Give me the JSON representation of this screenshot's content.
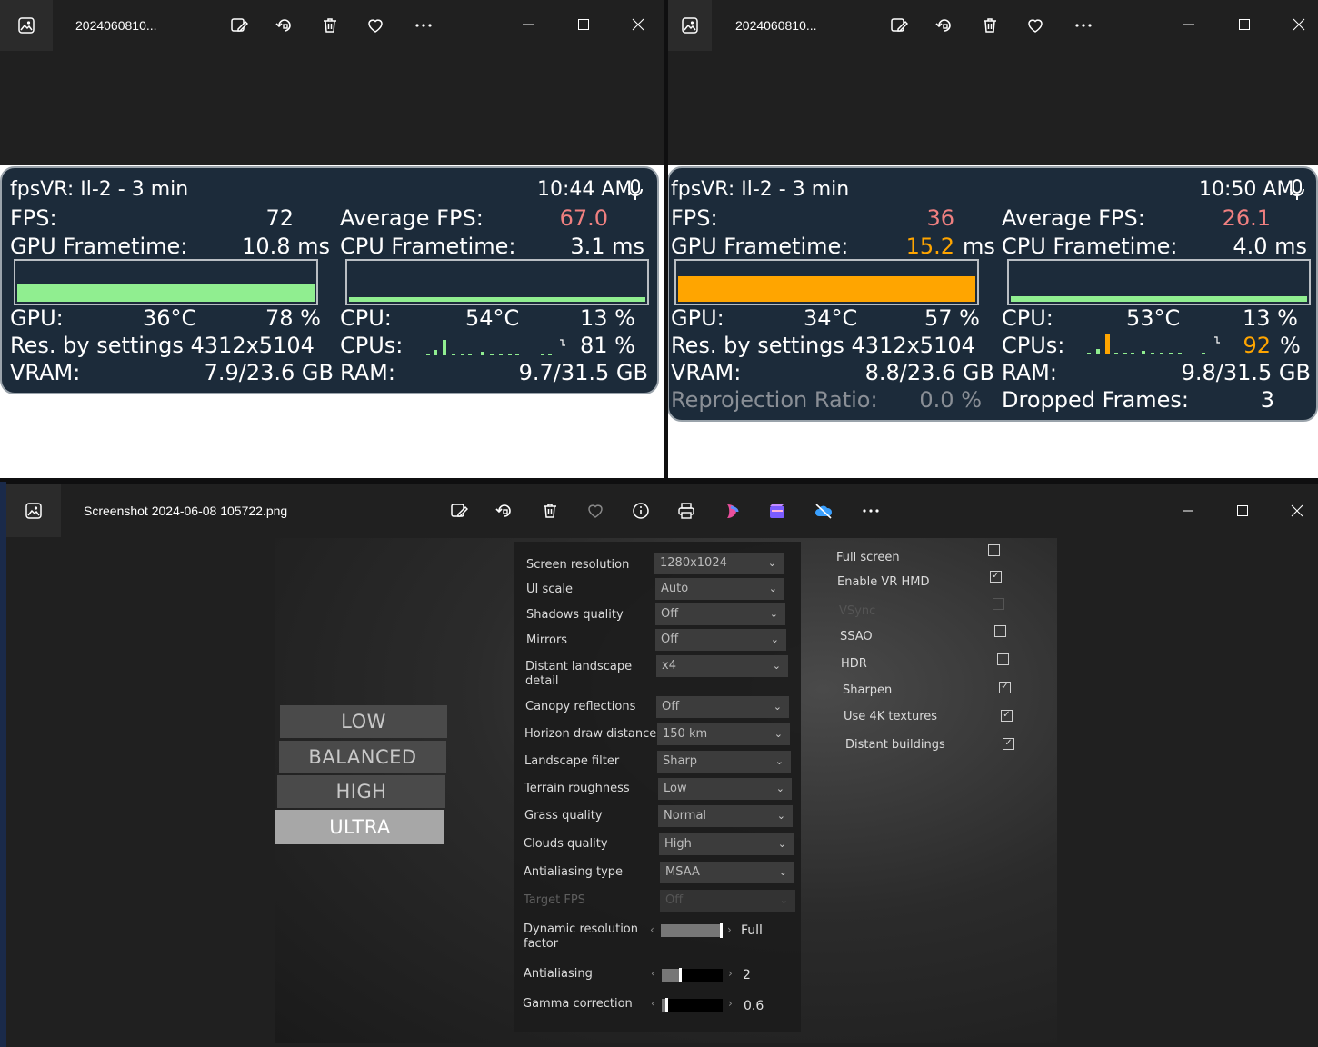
{
  "window_left": {
    "title": "2024060810...",
    "overlay": {
      "header": "fpsVR: Il-2 - 3 min",
      "time": "10:44 AM",
      "fps_label": "FPS:",
      "fps_value": "72",
      "avg_fps_label": "Average FPS:",
      "avg_fps_value": "67.0",
      "gpu_ft_label": "GPU Frametime:",
      "gpu_ft_value": "10.8 ms",
      "cpu_ft_label": "CPU Frametime:",
      "cpu_ft_value": "3.1 ms",
      "gpu_label": "GPU:",
      "gpu_temp": "36°C",
      "gpu_load": "78 %",
      "cpu_label": "CPU:",
      "cpu_temp": "54°C",
      "cpu_load": "13 %",
      "res_label": "Res. by settings 4312x5104",
      "cpus_label": "CPUs:",
      "cpus_value": "81 %",
      "vram_label": "VRAM:",
      "vram_value": "7.9/23.6 GB",
      "ram_label": "RAM:",
      "ram_value": "9.7/31.5 GB",
      "gpu_bar_color": "#90ee90",
      "avg_color": "#f08080"
    }
  },
  "window_right": {
    "title": "2024060810...",
    "overlay": {
      "header": "fpsVR: Il-2 - 3 min",
      "time": "10:50 AM",
      "fps_label": "FPS:",
      "fps_value": "36",
      "avg_fps_label": "Average FPS:",
      "avg_fps_value": "26.1",
      "gpu_ft_label": "GPU Frametime:",
      "gpu_ft_value": "15.2",
      "gpu_ft_unit": "ms",
      "cpu_ft_label": "CPU Frametime:",
      "cpu_ft_value": "4.0 ms",
      "gpu_label": "GPU:",
      "gpu_temp": "34°C",
      "gpu_load": "57 %",
      "cpu_label": "CPU:",
      "cpu_temp": "53°C",
      "cpu_load": "13 %",
      "res_label": "Res. by settings 4312x5104",
      "cpus_label": "CPUs:",
      "cpus_value": "92",
      "cpus_unit": "%",
      "vram_label": "VRAM:",
      "vram_value": "8.8/23.6 GB",
      "ram_label": "RAM:",
      "ram_value": "9.8/31.5 GB",
      "reproj_label": "Reprojection Ratio:",
      "reproj_value": "0.0 %",
      "dropped_label": "Dropped Frames:",
      "dropped_value": "3",
      "gpu_bar_color": "#ffa500",
      "warn_color": "#f08080",
      "orange_color": "#ffa500"
    }
  },
  "window_bottom": {
    "title": "Screenshot 2024-06-08 105722.png",
    "presets": [
      "LOW",
      "BALANCED",
      "HIGH",
      "ULTRA"
    ],
    "settings": [
      {
        "label": "Screen resolution",
        "value": "1280x1024"
      },
      {
        "label": "UI scale",
        "value": "Auto"
      },
      {
        "label": "Shadows quality",
        "value": "Off"
      },
      {
        "label": "Mirrors",
        "value": "Off"
      },
      {
        "label": "Distant landscape detail",
        "value": "x4"
      },
      {
        "label": "Canopy reflections",
        "value": "Off"
      },
      {
        "label": "Horizon draw distance",
        "value": "150 km"
      },
      {
        "label": "Landscape filter",
        "value": "Sharp"
      },
      {
        "label": "Terrain roughness",
        "value": "Low"
      },
      {
        "label": "Grass quality",
        "value": "Normal"
      },
      {
        "label": "Clouds quality",
        "value": "High"
      },
      {
        "label": "Antialiasing type",
        "value": "MSAA"
      },
      {
        "label": "Target FPS",
        "value": "Off"
      }
    ],
    "sliders": [
      {
        "label": "Dynamic resolution factor",
        "value": "Full",
        "level": 1.0
      },
      {
        "label": "Antialiasing",
        "value": "2",
        "level": 0.33
      },
      {
        "label": "Gamma correction",
        "value": "0.6",
        "level": 0.1
      }
    ],
    "checkboxes": [
      {
        "label": "Full screen",
        "checked": false
      },
      {
        "label": "Enable VR HMD",
        "checked": true
      },
      {
        "label": "VSync",
        "checked": false
      },
      {
        "label": "SSAO",
        "checked": false
      },
      {
        "label": "HDR",
        "checked": false
      },
      {
        "label": "Sharpen",
        "checked": true
      },
      {
        "label": "Use 4K textures",
        "checked": true
      },
      {
        "label": "Distant buildings",
        "checked": true
      }
    ]
  }
}
